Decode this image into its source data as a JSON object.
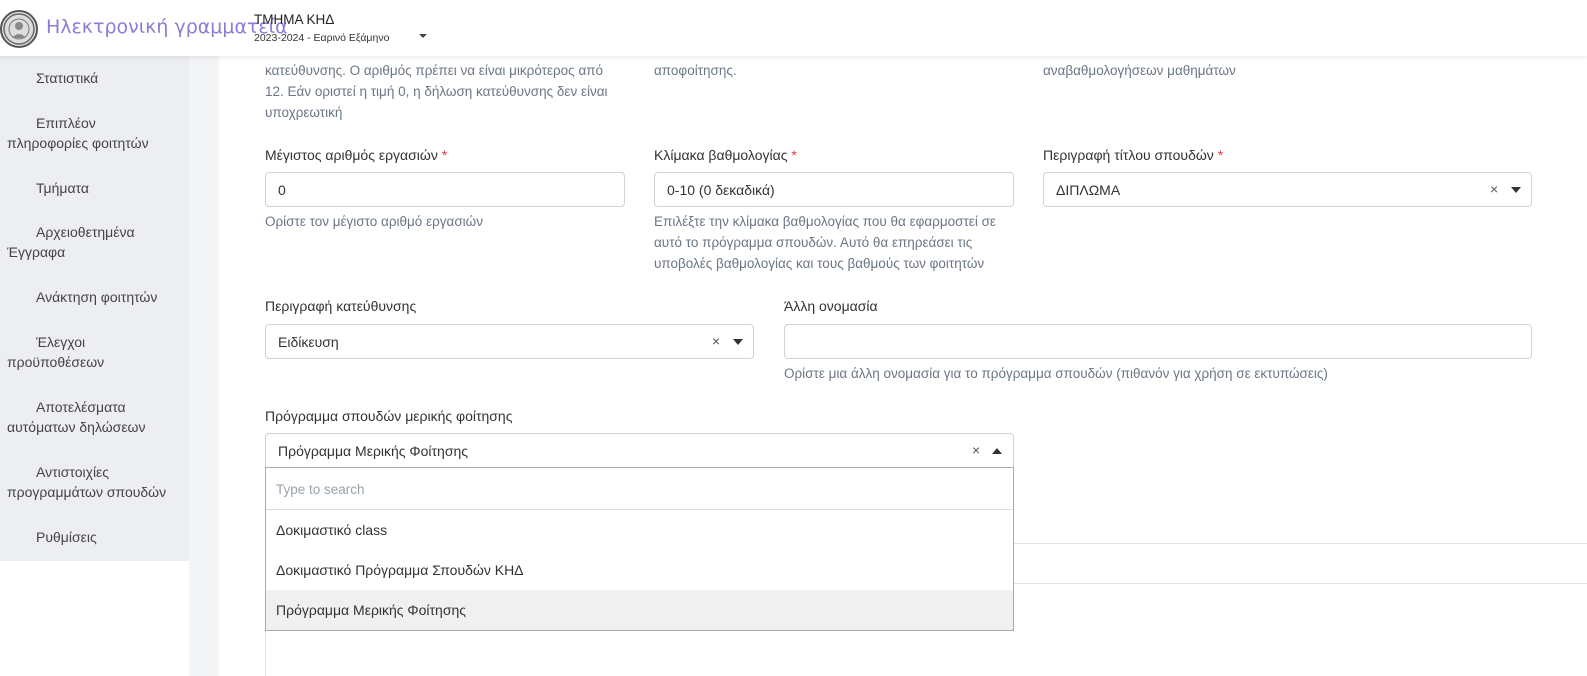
{
  "header": {
    "app_title": "Ηλεκτρονική γραμματεία",
    "department": "ΤΜΗΜΑ ΚΗΔ",
    "semester": "2023-2024 - Εαρινό Εξάμηνο"
  },
  "sidebar": {
    "items": [
      {
        "line1": "Στατιστικά",
        "line2": ""
      },
      {
        "line1": "Επιπλέον",
        "line2": "πληροφορίες φοιτητών"
      },
      {
        "line1": "Τμήματα",
        "line2": ""
      },
      {
        "line1": "Αρχειοθετημένα",
        "line2": "Έγγραφα"
      },
      {
        "line1": "Ανάκτηση φοιτητών",
        "line2": ""
      },
      {
        "line1": "Έλεγχοι",
        "line2": "προϋποθέσεων"
      },
      {
        "line1": "Αποτελέσματα",
        "line2": "αυτόματων δηλώσεων"
      },
      {
        "line1": "Αντιστοιχίες",
        "line2": "προγραμμάτων σπουδών"
      },
      {
        "line1": "Ρυθμίσεις",
        "line2": ""
      }
    ]
  },
  "form": {
    "top_help_1": [
      "κατεύθυνσης. Ο αριθμός πρέπει να είναι μικρότερος από",
      "12. Εάν οριστεί η τιμή 0, η δήλωση κατεύθυνσης δεν είναι",
      "υποχρεωτική"
    ],
    "top_help_2": "αποφοίτησης.",
    "top_help_3": "αναβαθμολογήσεων μαθημάτων",
    "max_works": {
      "label": "Μέγιστος αριθμός εργασιών",
      "required": "*",
      "value": "0",
      "help": "Ορίστε τον μέγιστο αριθμό εργασιών"
    },
    "grade_scale": {
      "label": "Κλίμακα βαθμολογίας",
      "required": "*",
      "value": "0-10 (0 δεκαδικά)",
      "help": [
        "Επιλέξτε την κλίμακα βαθμολογίας που θα εφαρμοστεί σε",
        "αυτό το πρόγραμμα σπουδών. Αυτό θα επηρεάσει τις",
        "υποβολές βαθμολογίας και τους βαθμούς των φοιτητών"
      ]
    },
    "degree_title": {
      "label": "Περιγραφή τίτλου σπουδών",
      "required": "*",
      "value": "ΔΙΠΛΩΜΑ",
      "clear": "×"
    },
    "specialization": {
      "label": "Περιγραφή κατεύθυνσης",
      "value": "Ειδίκευση",
      "clear": "×"
    },
    "alt_name": {
      "label": "Άλλη ονομασία",
      "value": "",
      "help": "Ορίστε μια άλλη ονομασία για το πρόγραμμα σπουδών (πιθανόν για χρήση σε εκτυπώσεις)"
    },
    "part_time": {
      "label": "Πρόγραμμα σπουδών μερικής φοίτησης",
      "value": "Πρόγραμμα Μερικής Φοίτησης",
      "clear": "×",
      "search_placeholder": "Type to search",
      "options": [
        "Δοκιμαστικό class",
        "Δοκιμαστικό Πρόγραμμα Σπουδών ΚΗΔ",
        "Πρόγραμμα Μερικής Φοίτησης"
      ],
      "selected_index": 2
    }
  },
  "colors": {
    "accent": "#8b7cd6",
    "required": "#e53935",
    "sidebar_bg": "#eceef1",
    "help_text": "#6b7685"
  }
}
